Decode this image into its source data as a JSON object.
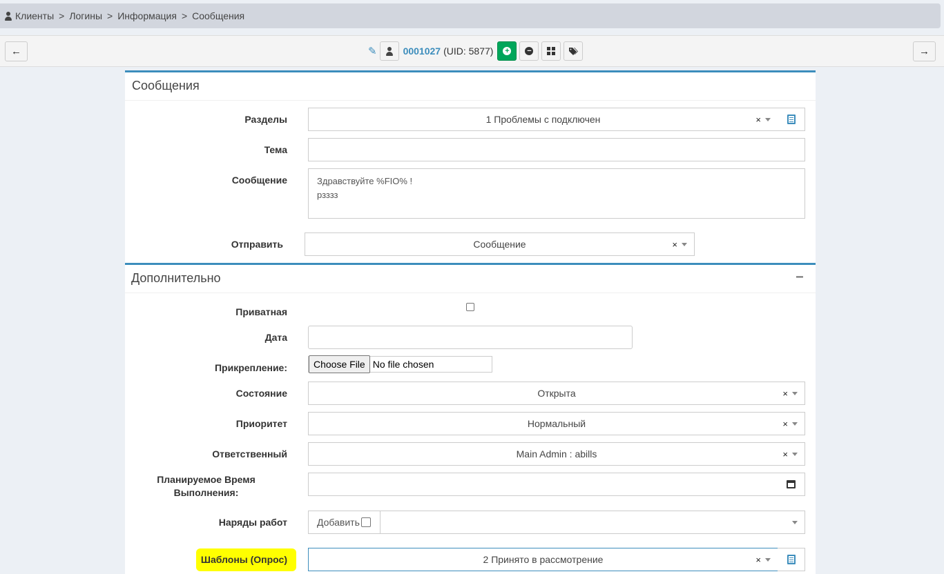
{
  "breadcrumb": {
    "items": [
      "Клиенты",
      "Логины",
      "Информация",
      "Сообщения"
    ],
    "separator": ">"
  },
  "toolbar": {
    "back_icon": "arrow-left",
    "forward_icon": "arrow-right",
    "login": "0001027",
    "uid": "(UID: 5877)"
  },
  "messages_section": {
    "title": "Сообщения",
    "sections_label": "Разделы",
    "sections_value": "1 Проблемы с подключен",
    "subject_label": "Тема",
    "subject_value": "",
    "message_label": "Сообщение",
    "message_line1": "Здравствуйте %FIO% !",
    "message_line2": "рзззз",
    "send_label": "Отправить",
    "send_value": "Сообщение"
  },
  "additional_section": {
    "title": "Дополнительно",
    "collapse_symbol": "−",
    "private_label": "Приватная",
    "date_label": "Дата",
    "date_value": "",
    "attachment_label": "Прикрепление:",
    "choose_file": "Choose File",
    "no_file": "No file chosen",
    "state_label": "Состояние",
    "state_value": "Открыта",
    "priority_label": "Приоритет",
    "priority_value": "Нормальный",
    "responsible_label": "Ответственный",
    "responsible_value": "Main Admin : abills",
    "planned_time_label_1": "Планируемое Время",
    "planned_time_label_2": "Выполнения:",
    "planned_time_value": "",
    "work_orders_label": "Наряды работ",
    "work_orders_add": "Добавить",
    "templates_label": "Шаблоны (Опрос)",
    "templates_value": "2 Принято в рассмотрение"
  },
  "clear_symbol": "×",
  "colors": {
    "accent": "#3c8dbc",
    "green": "#00a65a",
    "highlight": "#ffff00"
  }
}
